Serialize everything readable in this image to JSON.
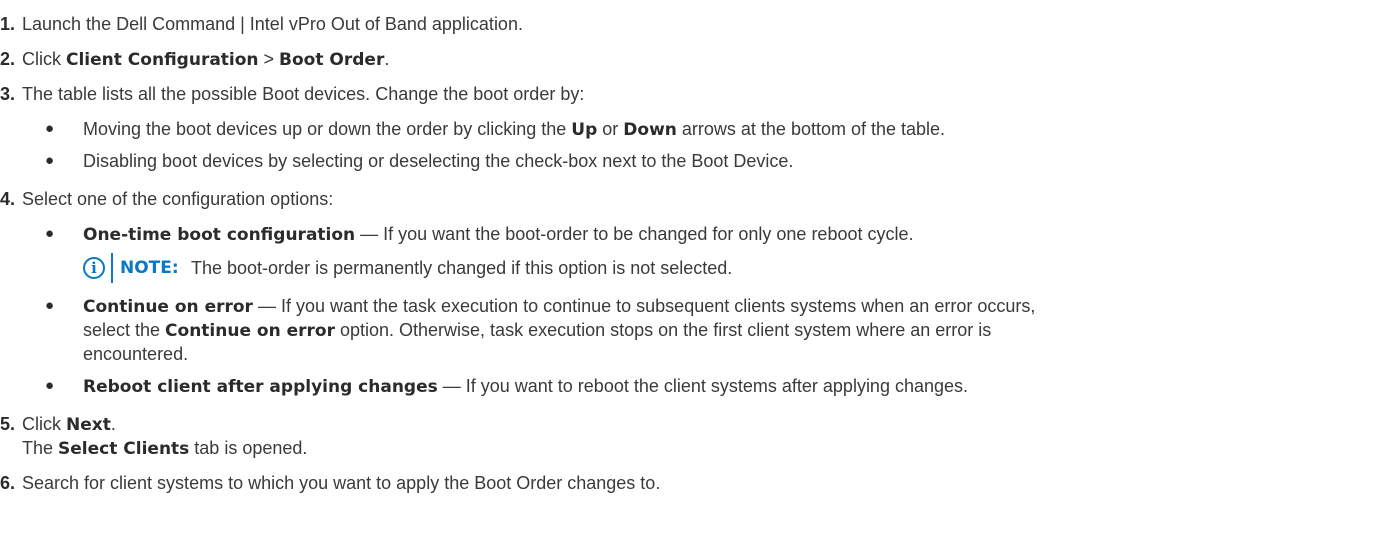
{
  "steps": [
    {
      "num": "1.",
      "text": "Launch the Dell Command | Intel vPro Out of Band application."
    },
    {
      "num": "2.",
      "pre": "Click ",
      "b1": "Client Configuration",
      "mid": " > ",
      "b2": "Boot Order",
      "post": "."
    },
    {
      "num": "3.",
      "text": "The table lists all the possible Boot devices. Change the boot order by:",
      "bullets": [
        {
          "pre": "Moving the boot devices up or down the order by clicking the ",
          "b1": "Up",
          "mid": " or ",
          "b2": "Down",
          "post": " arrows at the bottom of the table."
        },
        {
          "text": "Disabling boot devices by selecting or deselecting the check-box next to the Boot Device."
        }
      ]
    },
    {
      "num": "4.",
      "text": "Select one of the configuration options:",
      "bullets": [
        {
          "b": "One-time boot configuration",
          "text": " — If you want the boot-order to be changed for only one reboot cycle."
        },
        {
          "b": "Continue on error",
          "line1": " — If you want the task execution to continue to subsequent clients systems when an error occurs,",
          "line2_pre": "select the ",
          "line2_b": "Continue on error",
          "line2_post": " option. Otherwise, task execution stops on the first client system where an error is",
          "line3": "encountered."
        },
        {
          "b": "Reboot client after applying changes",
          "text": " — If you want to reboot the client systems after applying changes."
        }
      ]
    },
    {
      "num": "5.",
      "pre": "Click ",
      "b": "Next",
      "post": ".",
      "line2_pre": "The ",
      "line2_b": "Select Clients",
      "line2_post": " tab is opened."
    },
    {
      "num": "6.",
      "text": "Search for client systems to which you want to apply the Boot Order changes to."
    }
  ],
  "note": {
    "icon": "info-icon",
    "label": "NOTE:",
    "text": "The boot-order is permanently changed if this option is not selected."
  },
  "bullet_glyph": "●",
  "note_icon_glyph": "i"
}
